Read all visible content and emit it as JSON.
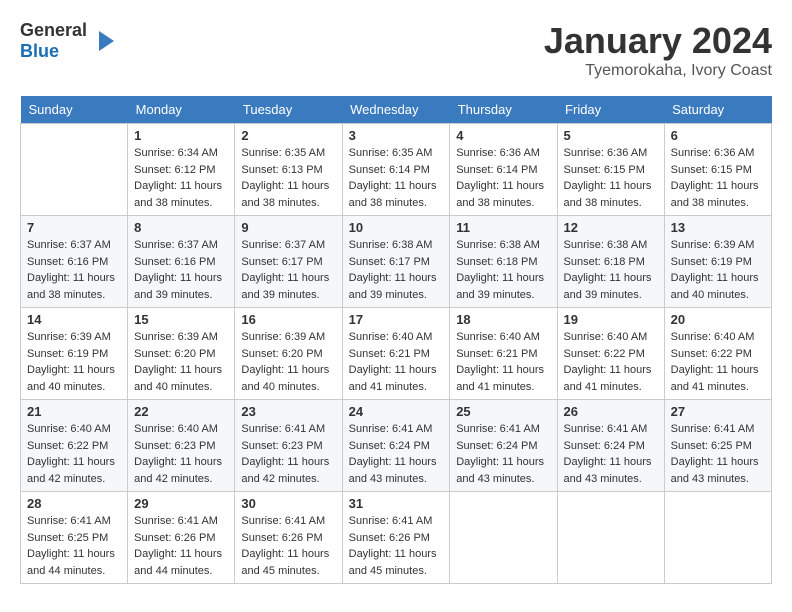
{
  "logo": {
    "general": "General",
    "blue": "Blue"
  },
  "title": "January 2024",
  "subtitle": "Tyemorokaha, Ivory Coast",
  "days_header": [
    "Sunday",
    "Monday",
    "Tuesday",
    "Wednesday",
    "Thursday",
    "Friday",
    "Saturday"
  ],
  "weeks": [
    [
      {
        "day": "",
        "sunrise": "",
        "sunset": "",
        "daylight": ""
      },
      {
        "day": "1",
        "sunrise": "Sunrise: 6:34 AM",
        "sunset": "Sunset: 6:12 PM",
        "daylight": "Daylight: 11 hours and 38 minutes."
      },
      {
        "day": "2",
        "sunrise": "Sunrise: 6:35 AM",
        "sunset": "Sunset: 6:13 PM",
        "daylight": "Daylight: 11 hours and 38 minutes."
      },
      {
        "day": "3",
        "sunrise": "Sunrise: 6:35 AM",
        "sunset": "Sunset: 6:14 PM",
        "daylight": "Daylight: 11 hours and 38 minutes."
      },
      {
        "day": "4",
        "sunrise": "Sunrise: 6:36 AM",
        "sunset": "Sunset: 6:14 PM",
        "daylight": "Daylight: 11 hours and 38 minutes."
      },
      {
        "day": "5",
        "sunrise": "Sunrise: 6:36 AM",
        "sunset": "Sunset: 6:15 PM",
        "daylight": "Daylight: 11 hours and 38 minutes."
      },
      {
        "day": "6",
        "sunrise": "Sunrise: 6:36 AM",
        "sunset": "Sunset: 6:15 PM",
        "daylight": "Daylight: 11 hours and 38 minutes."
      }
    ],
    [
      {
        "day": "7",
        "sunrise": "Sunrise: 6:37 AM",
        "sunset": "Sunset: 6:16 PM",
        "daylight": "Daylight: 11 hours and 38 minutes."
      },
      {
        "day": "8",
        "sunrise": "Sunrise: 6:37 AM",
        "sunset": "Sunset: 6:16 PM",
        "daylight": "Daylight: 11 hours and 39 minutes."
      },
      {
        "day": "9",
        "sunrise": "Sunrise: 6:37 AM",
        "sunset": "Sunset: 6:17 PM",
        "daylight": "Daylight: 11 hours and 39 minutes."
      },
      {
        "day": "10",
        "sunrise": "Sunrise: 6:38 AM",
        "sunset": "Sunset: 6:17 PM",
        "daylight": "Daylight: 11 hours and 39 minutes."
      },
      {
        "day": "11",
        "sunrise": "Sunrise: 6:38 AM",
        "sunset": "Sunset: 6:18 PM",
        "daylight": "Daylight: 11 hours and 39 minutes."
      },
      {
        "day": "12",
        "sunrise": "Sunrise: 6:38 AM",
        "sunset": "Sunset: 6:18 PM",
        "daylight": "Daylight: 11 hours and 39 minutes."
      },
      {
        "day": "13",
        "sunrise": "Sunrise: 6:39 AM",
        "sunset": "Sunset: 6:19 PM",
        "daylight": "Daylight: 11 hours and 40 minutes."
      }
    ],
    [
      {
        "day": "14",
        "sunrise": "Sunrise: 6:39 AM",
        "sunset": "Sunset: 6:19 PM",
        "daylight": "Daylight: 11 hours and 40 minutes."
      },
      {
        "day": "15",
        "sunrise": "Sunrise: 6:39 AM",
        "sunset": "Sunset: 6:20 PM",
        "daylight": "Daylight: 11 hours and 40 minutes."
      },
      {
        "day": "16",
        "sunrise": "Sunrise: 6:39 AM",
        "sunset": "Sunset: 6:20 PM",
        "daylight": "Daylight: 11 hours and 40 minutes."
      },
      {
        "day": "17",
        "sunrise": "Sunrise: 6:40 AM",
        "sunset": "Sunset: 6:21 PM",
        "daylight": "Daylight: 11 hours and 41 minutes."
      },
      {
        "day": "18",
        "sunrise": "Sunrise: 6:40 AM",
        "sunset": "Sunset: 6:21 PM",
        "daylight": "Daylight: 11 hours and 41 minutes."
      },
      {
        "day": "19",
        "sunrise": "Sunrise: 6:40 AM",
        "sunset": "Sunset: 6:22 PM",
        "daylight": "Daylight: 11 hours and 41 minutes."
      },
      {
        "day": "20",
        "sunrise": "Sunrise: 6:40 AM",
        "sunset": "Sunset: 6:22 PM",
        "daylight": "Daylight: 11 hours and 41 minutes."
      }
    ],
    [
      {
        "day": "21",
        "sunrise": "Sunrise: 6:40 AM",
        "sunset": "Sunset: 6:22 PM",
        "daylight": "Daylight: 11 hours and 42 minutes."
      },
      {
        "day": "22",
        "sunrise": "Sunrise: 6:40 AM",
        "sunset": "Sunset: 6:23 PM",
        "daylight": "Daylight: 11 hours and 42 minutes."
      },
      {
        "day": "23",
        "sunrise": "Sunrise: 6:41 AM",
        "sunset": "Sunset: 6:23 PM",
        "daylight": "Daylight: 11 hours and 42 minutes."
      },
      {
        "day": "24",
        "sunrise": "Sunrise: 6:41 AM",
        "sunset": "Sunset: 6:24 PM",
        "daylight": "Daylight: 11 hours and 43 minutes."
      },
      {
        "day": "25",
        "sunrise": "Sunrise: 6:41 AM",
        "sunset": "Sunset: 6:24 PM",
        "daylight": "Daylight: 11 hours and 43 minutes."
      },
      {
        "day": "26",
        "sunrise": "Sunrise: 6:41 AM",
        "sunset": "Sunset: 6:24 PM",
        "daylight": "Daylight: 11 hours and 43 minutes."
      },
      {
        "day": "27",
        "sunrise": "Sunrise: 6:41 AM",
        "sunset": "Sunset: 6:25 PM",
        "daylight": "Daylight: 11 hours and 43 minutes."
      }
    ],
    [
      {
        "day": "28",
        "sunrise": "Sunrise: 6:41 AM",
        "sunset": "Sunset: 6:25 PM",
        "daylight": "Daylight: 11 hours and 44 minutes."
      },
      {
        "day": "29",
        "sunrise": "Sunrise: 6:41 AM",
        "sunset": "Sunset: 6:26 PM",
        "daylight": "Daylight: 11 hours and 44 minutes."
      },
      {
        "day": "30",
        "sunrise": "Sunrise: 6:41 AM",
        "sunset": "Sunset: 6:26 PM",
        "daylight": "Daylight: 11 hours and 45 minutes."
      },
      {
        "day": "31",
        "sunrise": "Sunrise: 6:41 AM",
        "sunset": "Sunset: 6:26 PM",
        "daylight": "Daylight: 11 hours and 45 minutes."
      },
      {
        "day": "",
        "sunrise": "",
        "sunset": "",
        "daylight": ""
      },
      {
        "day": "",
        "sunrise": "",
        "sunset": "",
        "daylight": ""
      },
      {
        "day": "",
        "sunrise": "",
        "sunset": "",
        "daylight": ""
      }
    ]
  ]
}
